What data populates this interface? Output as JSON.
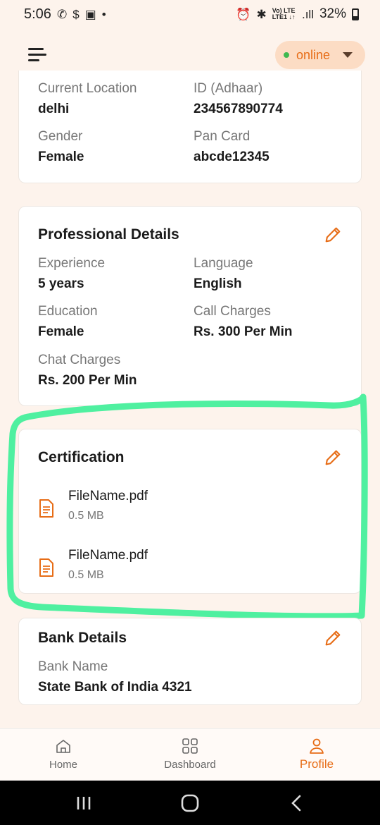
{
  "status_bar": {
    "time": "5:06",
    "battery": "32%",
    "network_top": "Vo) LTE",
    "network_bottom": "LTE1 ↓↑"
  },
  "header": {
    "status_label": "online",
    "status_color": "#3fb950",
    "accent": "#e76d17"
  },
  "personal": {
    "fields": [
      {
        "label": "Current Location",
        "value": "delhi"
      },
      {
        "label": "ID (Adhaar)",
        "value": "234567890774"
      },
      {
        "label": "Gender",
        "value": "Female"
      },
      {
        "label": "Pan Card",
        "value": "abcde12345"
      }
    ]
  },
  "professional": {
    "title": "Professional Details",
    "fields": [
      {
        "label": "Experience",
        "value": "5 years"
      },
      {
        "label": "Language",
        "value": "English"
      },
      {
        "label": "Education",
        "value": "Female"
      },
      {
        "label": "Call Charges",
        "value": "Rs. 300 Per Min"
      },
      {
        "label": "Chat Charges",
        "value": "Rs. 200 Per Min"
      }
    ]
  },
  "certification": {
    "title": "Certification",
    "files": [
      {
        "name": "FileName.pdf",
        "size": "0.5 MB"
      },
      {
        "name": "FileName.pdf",
        "size": "0.5 MB"
      }
    ]
  },
  "bank": {
    "title": "Bank Details",
    "fields": [
      {
        "label": "Bank Name",
        "value": "State Bank of India 4321"
      }
    ]
  },
  "bottom_nav": [
    {
      "label": "Home",
      "icon": "home-icon"
    },
    {
      "label": "Dashboard",
      "icon": "grid-icon"
    },
    {
      "label": "Profile",
      "icon": "user-icon",
      "active": true
    }
  ],
  "highlight_color": "#4ff0a0"
}
